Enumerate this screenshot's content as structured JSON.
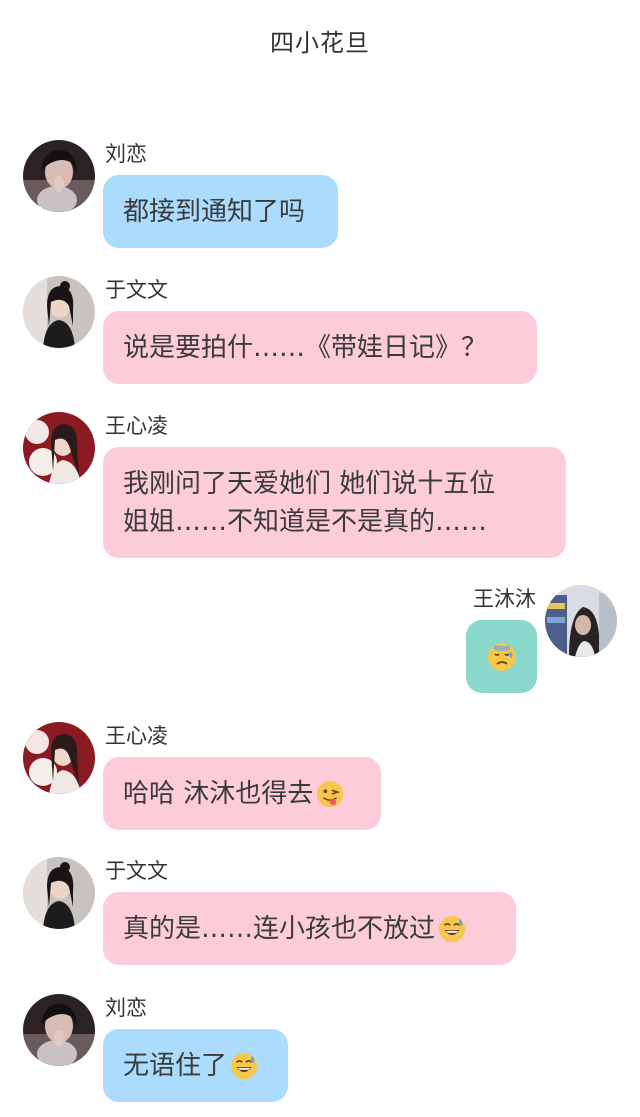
{
  "header": {
    "title": "四小花旦"
  },
  "messages": [
    {
      "sender": "刘恋",
      "text": "都接到通知了吗",
      "emoji": ""
    },
    {
      "sender": "于文文",
      "text": "说是要拍什……《带娃日记》？",
      "emoji": ""
    },
    {
      "sender": "王心凌",
      "text": "我刚问了天爱她们 她们说十五位\n姐姐……不知道是不是真的……",
      "emoji": ""
    },
    {
      "sender": "王沐沐",
      "text": "",
      "emoji": "downcast-sweat-emoji"
    },
    {
      "sender": "王心凌",
      "text": "哈哈 沐沐也得去",
      "emoji": "winking-tongue-emoji"
    },
    {
      "sender": "于文文",
      "text": "真的是……连小孩也不放过",
      "emoji": "grinning-sweat-emoji"
    },
    {
      "sender": "刘恋",
      "text": "无语住了",
      "emoji": "grinning-sweat-emoji"
    }
  ],
  "colors": {
    "bubble_blue": "#abdcfd",
    "bubble_pink": "#fcccd9",
    "bubble_teal": "#8ad7cb"
  }
}
